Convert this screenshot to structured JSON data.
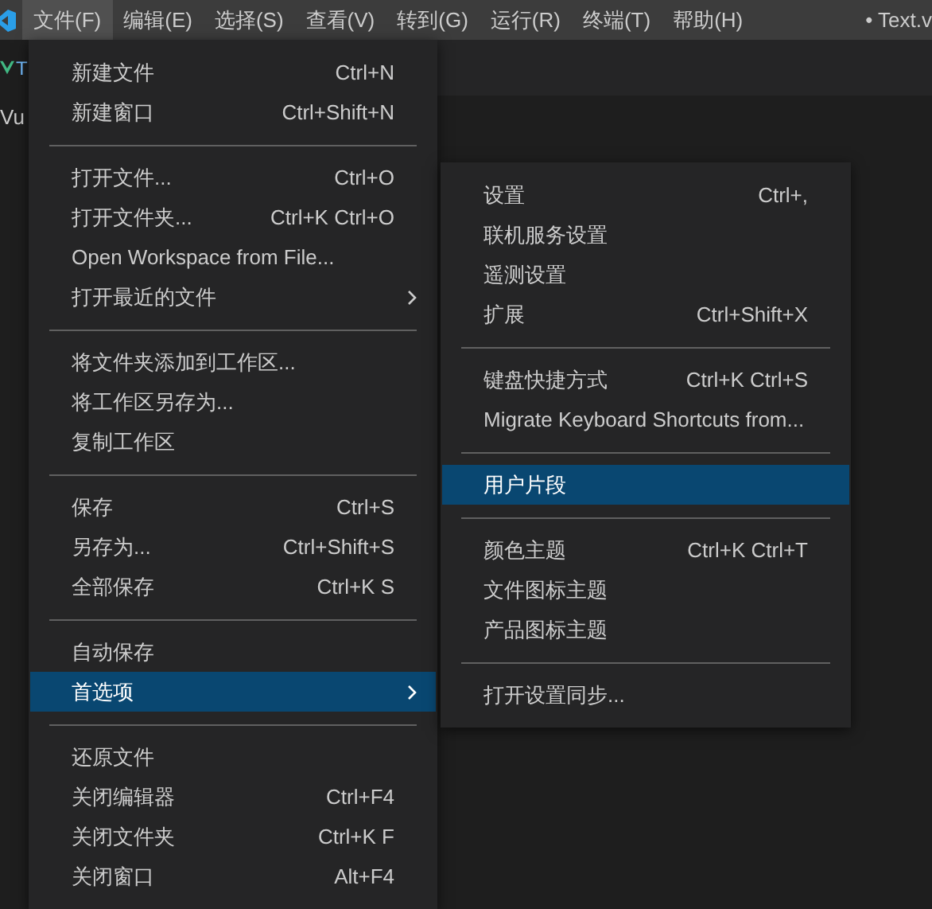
{
  "menubar": {
    "items": [
      {
        "label": "文件(F)",
        "selected": true
      },
      {
        "label": "编辑(E)",
        "selected": false
      },
      {
        "label": "选择(S)",
        "selected": false
      },
      {
        "label": "查看(V)",
        "selected": false
      },
      {
        "label": "转到(G)",
        "selected": false
      },
      {
        "label": "运行(R)",
        "selected": false
      },
      {
        "label": "终端(T)",
        "selected": false
      },
      {
        "label": "帮助(H)",
        "selected": false
      }
    ],
    "title": "• Text.v"
  },
  "editor": {
    "tab_label": "T",
    "breadcrumb": "Vu"
  },
  "file_menu": {
    "groups": [
      [
        {
          "label": "新建文件",
          "shortcut": "Ctrl+N",
          "submenu": false,
          "selected": false
        },
        {
          "label": "新建窗口",
          "shortcut": "Ctrl+Shift+N",
          "submenu": false,
          "selected": false
        }
      ],
      [
        {
          "label": "打开文件...",
          "shortcut": "Ctrl+O",
          "submenu": false,
          "selected": false
        },
        {
          "label": "打开文件夹...",
          "shortcut": "Ctrl+K Ctrl+O",
          "submenu": false,
          "selected": false
        },
        {
          "label": "Open Workspace from File...",
          "submenu": false,
          "selected": false
        },
        {
          "label": "打开最近的文件",
          "submenu": true,
          "selected": false
        }
      ],
      [
        {
          "label": "将文件夹添加到工作区...",
          "submenu": false,
          "selected": false
        },
        {
          "label": "将工作区另存为...",
          "submenu": false,
          "selected": false
        },
        {
          "label": "复制工作区",
          "submenu": false,
          "selected": false
        }
      ],
      [
        {
          "label": "保存",
          "shortcut": "Ctrl+S",
          "submenu": false,
          "selected": false
        },
        {
          "label": "另存为...",
          "shortcut": "Ctrl+Shift+S",
          "submenu": false,
          "selected": false
        },
        {
          "label": "全部保存",
          "shortcut": "Ctrl+K S",
          "submenu": false,
          "selected": false
        }
      ],
      [
        {
          "label": "自动保存",
          "submenu": false,
          "selected": false
        },
        {
          "label": "首选项",
          "submenu": true,
          "selected": true
        }
      ],
      [
        {
          "label": "还原文件",
          "submenu": false,
          "selected": false
        },
        {
          "label": "关闭编辑器",
          "shortcut": "Ctrl+F4",
          "submenu": false,
          "selected": false
        },
        {
          "label": "关闭文件夹",
          "shortcut": "Ctrl+K F",
          "submenu": false,
          "selected": false
        },
        {
          "label": "关闭窗口",
          "shortcut": "Alt+F4",
          "submenu": false,
          "selected": false
        }
      ]
    ]
  },
  "preferences_submenu": {
    "groups": [
      [
        {
          "label": "设置",
          "shortcut": "Ctrl+,",
          "selected": false
        },
        {
          "label": "联机服务设置",
          "selected": false
        },
        {
          "label": "遥测设置",
          "selected": false
        },
        {
          "label": "扩展",
          "shortcut": "Ctrl+Shift+X",
          "selected": false
        }
      ],
      [
        {
          "label": "键盘快捷方式",
          "shortcut": "Ctrl+K Ctrl+S",
          "selected": false
        },
        {
          "label": "Migrate Keyboard Shortcuts from...",
          "selected": false
        }
      ],
      [
        {
          "label": "用户片段",
          "selected": true
        }
      ],
      [
        {
          "label": "颜色主题",
          "shortcut": "Ctrl+K Ctrl+T",
          "selected": false
        },
        {
          "label": "文件图标主题",
          "selected": false
        },
        {
          "label": "产品图标主题",
          "selected": false
        }
      ],
      [
        {
          "label": "打开设置同步...",
          "selected": false
        }
      ]
    ]
  }
}
